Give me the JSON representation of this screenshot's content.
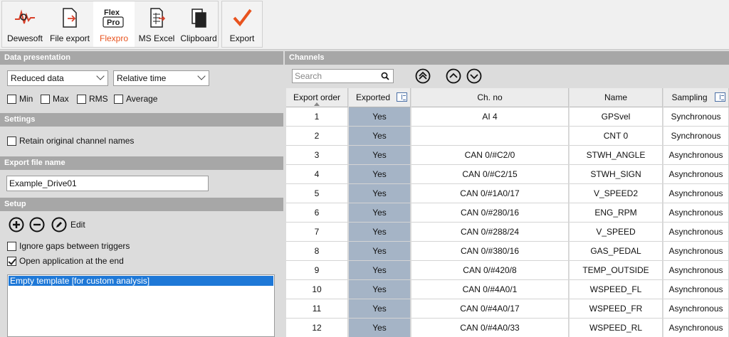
{
  "toolbar": {
    "buttons": [
      {
        "label": "Dewesoft",
        "icon": "dewesoft-icon"
      },
      {
        "label": "File export",
        "icon": "file-export-icon"
      },
      {
        "label": "Flexpro",
        "icon": "flexpro-icon",
        "icon_text_1": "Flex",
        "icon_text_2": "Pro"
      },
      {
        "label": "MS Excel",
        "icon": "excel-icon"
      },
      {
        "label": "Clipboard",
        "icon": "clipboard-icon"
      }
    ],
    "export_label": "Export",
    "active_color": "#e8531e"
  },
  "left": {
    "data_presentation": {
      "title": "Data presentation",
      "dropdown1": "Reduced data",
      "dropdown2": "Relative time",
      "checkboxes": [
        "Min",
        "Max",
        "RMS",
        "Average"
      ]
    },
    "settings": {
      "title": "Settings",
      "retain_label": "Retain original channel names"
    },
    "export_file": {
      "title": "Export file name",
      "value": "Example_Drive01"
    },
    "setup": {
      "title": "Setup",
      "edit_label": "Edit",
      "ignore_gaps_label": "Ignore gaps between triggers",
      "open_app_label": "Open application at the end",
      "templates": [
        "Empty template [for custom analysis]"
      ]
    }
  },
  "channels": {
    "title": "Channels",
    "search_placeholder": "Search",
    "columns": [
      "Export order",
      "Exported",
      "Ch. no",
      "Name",
      "Sampling"
    ],
    "rows": [
      {
        "order": "1",
        "exported": "Yes",
        "chno": "AI 4",
        "name": "GPSvel",
        "sampling": "Synchronous"
      },
      {
        "order": "2",
        "exported": "Yes",
        "chno": "",
        "name": "CNT 0",
        "sampling": "Synchronous"
      },
      {
        "order": "3",
        "exported": "Yes",
        "chno": "CAN 0/#C2/0",
        "name": "STWH_ANGLE",
        "sampling": "Asynchronous"
      },
      {
        "order": "4",
        "exported": "Yes",
        "chno": "CAN 0/#C2/15",
        "name": "STWH_SIGN",
        "sampling": "Asynchronous"
      },
      {
        "order": "5",
        "exported": "Yes",
        "chno": "CAN 0/#1A0/17",
        "name": "V_SPEED2",
        "sampling": "Asynchronous"
      },
      {
        "order": "6",
        "exported": "Yes",
        "chno": "CAN 0/#280/16",
        "name": "ENG_RPM",
        "sampling": "Asynchronous"
      },
      {
        "order": "7",
        "exported": "Yes",
        "chno": "CAN 0/#288/24",
        "name": "V_SPEED",
        "sampling": "Asynchronous"
      },
      {
        "order": "8",
        "exported": "Yes",
        "chno": "CAN 0/#380/16",
        "name": "GAS_PEDAL",
        "sampling": "Asynchronous"
      },
      {
        "order": "9",
        "exported": "Yes",
        "chno": "CAN 0/#420/8",
        "name": "TEMP_OUTSIDE",
        "sampling": "Asynchronous"
      },
      {
        "order": "10",
        "exported": "Yes",
        "chno": "CAN 0/#4A0/1",
        "name": "WSPEED_FL",
        "sampling": "Asynchronous"
      },
      {
        "order": "11",
        "exported": "Yes",
        "chno": "CAN 0/#4A0/17",
        "name": "WSPEED_FR",
        "sampling": "Asynchronous"
      },
      {
        "order": "12",
        "exported": "Yes",
        "chno": "CAN 0/#4A0/33",
        "name": "WSPEED_RL",
        "sampling": "Asynchronous"
      }
    ]
  }
}
